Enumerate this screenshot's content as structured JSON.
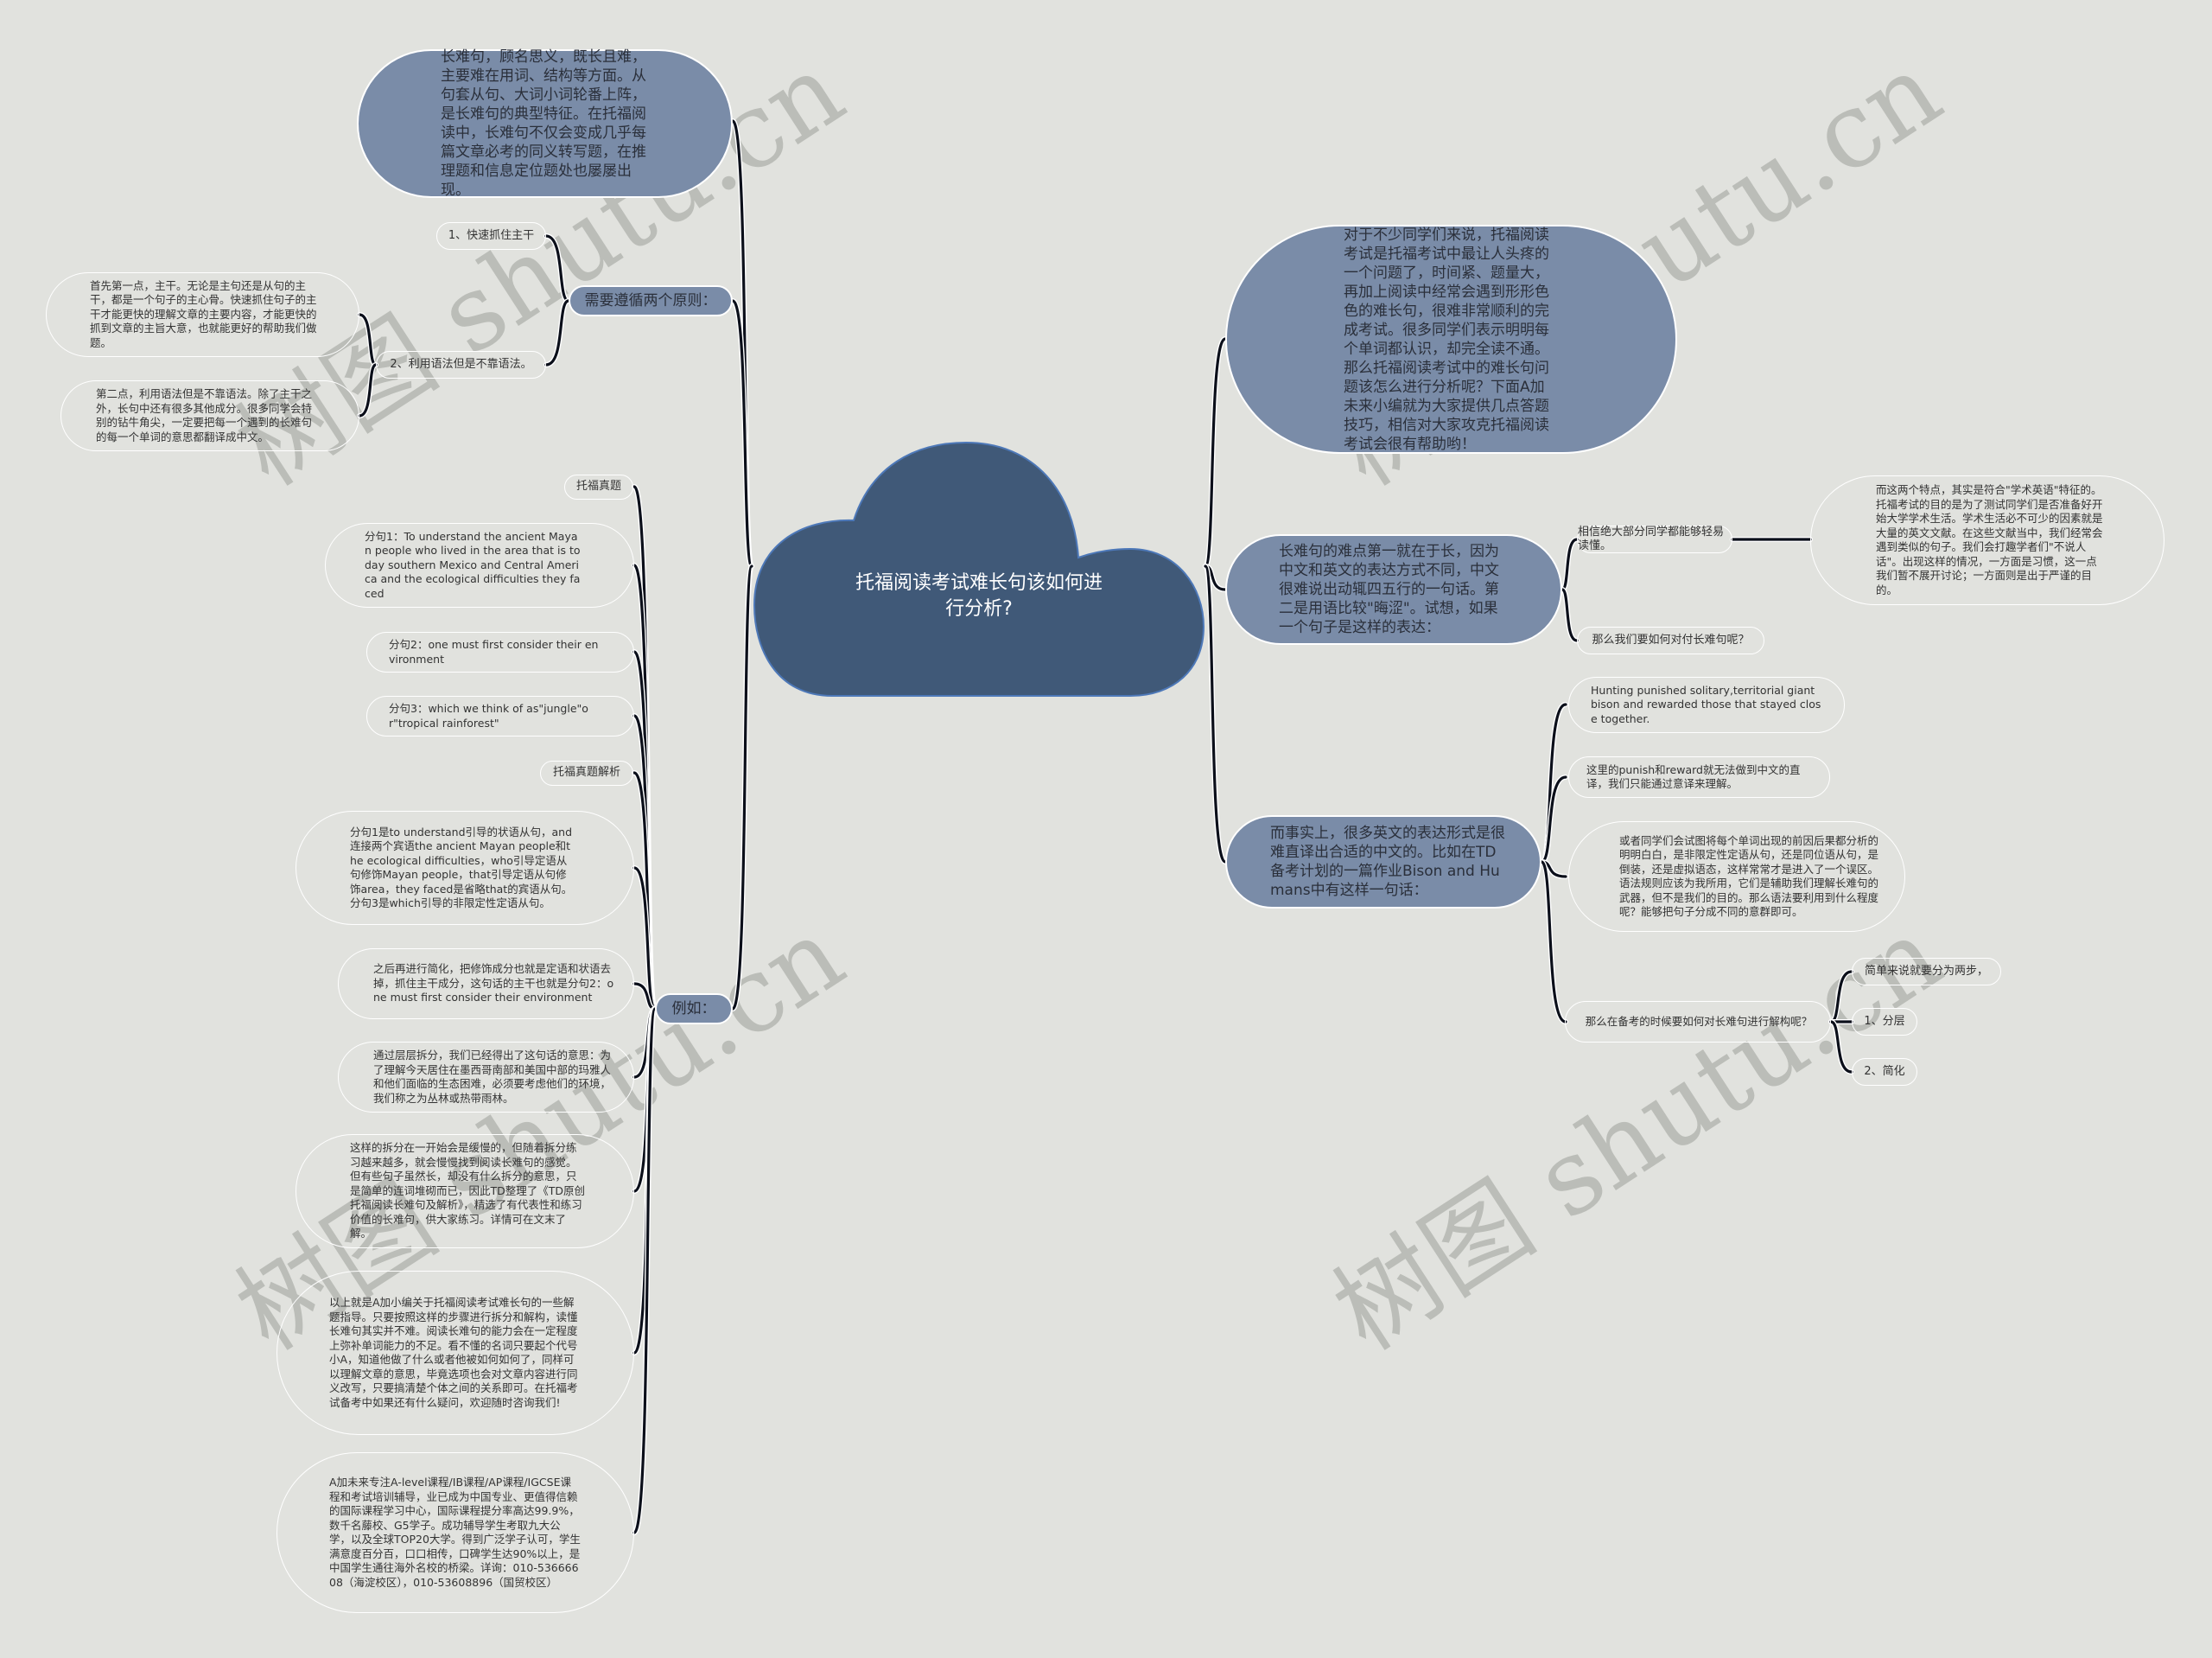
{
  "watermark": "树图 shutu.cn",
  "colors": {
    "background": "#e1e2de",
    "root": "#405978",
    "branch": "#7a8ca8",
    "connector": "#0b0f1a",
    "leaf_border": "#ffffff"
  },
  "root": {
    "title": "托福阅读考试难长句该如何进行分析?"
  },
  "left": {
    "intro": "长难句，顾名思义，既长且难，主要难在用词、结构等方面。从句套从句、大词小词轮番上阵，是长难句的典型特征。在托福阅读中，长难句不仅会变成几乎每篇文章必考的同义转写题，在推理题和信息定位题处也屡屡出现。",
    "principles": {
      "label": "需要遵循两个原则：",
      "items": [
        {
          "label": "1、快速抓住主干"
        },
        {
          "label": "2、利用语法但是不靠语法。",
          "details": [
            "首先第一点，主干。无论是主句还是从句的主干，都是一个句子的主心骨。快速抓住句子的主干才能更快的理解文章的主要内容，才能更快的抓到文章的主旨大意，也就能更好的帮助我们做题。",
            "第二点，利用语法但是不靠语法。除了主干之外，长句中还有很多其他成分。很多同学会特别的钻牛角尖，一定要把每一个遇到的长难句的每一个单词的意思都翻译成中文。"
          ]
        }
      ]
    },
    "example": {
      "label": "例如：",
      "items": [
        "托福真题",
        "分句1：To understand the ancient Mayan people who lived in the area that is today southern Mexico and Central America and the ecological difficulties they faced",
        "分句2：one must first consider their environment",
        "分句3：which we think of as\"jungle\"or\"tropical rainforest\"",
        "托福真题解析",
        "分句1是to understand引导的状语从句，and连接两个宾语the ancient Mayan people和the ecological difficulties，who引导定语从句修饰Mayan people，that引导定语从句修饰area，they faced是省略that的宾语从句。分句3是which引导的非限定性定语从句。",
        "之后再进行简化，把修饰成分也就是定语和状语去掉，抓住主干成分，这句话的主干也就是分句2：one must first consider their environment",
        "通过层层拆分，我们已经得出了这句话的意思：为了理解今天居住在墨西哥南部和美国中部的玛雅人和他们面临的生态困难，必须要考虑他们的环境，我们称之为丛林或热带雨林。",
        "这样的拆分在一开始会是缓慢的，但随着拆分练习越来越多，就会慢慢找到阅读长难句的感觉。但有些句子虽然长，却没有什么拆分的意思，只是简单的连词堆砌而已，因此TD整理了《TD原创托福阅读长难句及解析》，精选了有代表性和练习价值的长难句，供大家练习。详情可在文末了解。",
        "以上就是A加小编关于托福阅读考试难长句的一些解题指导。只要按照这样的步骤进行拆分和解构，读懂长难句其实并不难。阅读长难句的能力会在一定程度上弥补单词能力的不足。看不懂的名词只要起个代号小A，知道他做了什么或者他被如何如何了，同样可以理解文章的意思，毕竟选项也会对文章内容进行同义改写，只要搞清楚个体之间的关系即可。在托福考试备考中如果还有什么疑问，欢迎随时咨询我们!",
        "A加未来专注A-level课程/IB课程/AP课程/IGCSE课程和考试培训辅导，业已成为中国专业、更值得信赖的国际课程学习中心，国际课程提分率高达99.9%，数千名藤校、G5学子。成功辅导学生考取九大公学，以及全球TOP20大学。得到广泛学子认可，学生满意度百分百，口口相传，口碑学生达90%以上，是中国学生通往海外名校的桥梁。详询：010-53666608（海淀校区），010-53608896（国贸校区）"
      ]
    }
  },
  "right": {
    "intro": "对于不少同学们来说，托福阅读考试是托福考试中最让人头疼的一个问题了，时间紧、题量大，再加上阅读中经常会遇到形形色色的难长句，很难非常顺利的完成考试。很多同学们表示明明每个单词都认识，却完全读不通。那么托福阅读考试中的难长句问题该怎么进行分析呢？下面A加未来小编就为大家提供几点答题技巧，相信对大家攻克托福阅读考试会很有帮助哟！",
    "difficulty": {
      "label": "长难句的难点第一就在于长，因为中文和英文的表达方式不同，中文很难说出动辄四五行的一句话。第二是用语比较\"晦涩\"。试想，如果一个句子是这样的表达：",
      "items": [
        {
          "label": "相信绝大部分同学都能够轻易读懂。",
          "detail": "而这两个特点，其实是符合\"学术英语\"特征的。托福考试的目的是为了测试同学们是否准备好开始大学学术生活。学术生活必不可少的因素就是大量的英文文献。在这些文献当中，我们经常会遇到类似的句子。我们会打趣学者们\"不说人话\"。出现这样的情况，一方面是习惯，这一点我们暂不展开讨论；一方面则是出于严谨的目的。"
        },
        {
          "label": "那么我们要如何对付长难句呢？"
        }
      ]
    },
    "fact": {
      "label": "而事实上，很多英文的表达形式是很难直译出合适的中文的。比如在TD备考计划的一篇作业Bison and Humans中有这样一句话：",
      "items": [
        "Hunting punished solitary,territorial giant bison and rewarded those that stayed close together.",
        "这里的punish和reward就无法做到中文的直译，我们只能通过意译来理解。",
        "或者同学们会试图将每个单词出现的前因后果都分析的明明白白，是非限定性定语从句，还是同位语从句，是倒装，还是虚拟语态，这样常常才是进入了一个误区。语法规则应该为我所用，它们是辅助我们理解长难句的武器，但不是我们的目的。那么语法要利用到什么程度呢？能够把句子分成不同的意群即可。"
      ],
      "deconstruct": {
        "label": "那么在备考的时候要如何对长难句进行解构呢？",
        "steps": [
          "简单来说就要分为两步，",
          "1、分层",
          "2、简化"
        ]
      }
    }
  }
}
